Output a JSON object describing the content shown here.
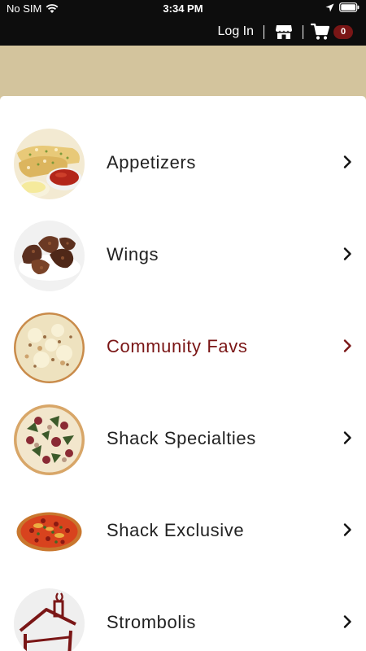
{
  "status_bar": {
    "carrier": "No SIM",
    "time": "3:34 PM"
  },
  "nav": {
    "login_label": "Log In",
    "cart_count": "0"
  },
  "colors": {
    "nav_bg": "#0d0d0d",
    "banner": "#d3c49d",
    "accent": "#7a1616",
    "text": "#222222"
  },
  "menu": {
    "items": [
      {
        "label": "Appetizers",
        "icon": "appetizers-thumbnail"
      },
      {
        "label": "Wings",
        "icon": "wings-thumbnail"
      },
      {
        "label": "Community Favs",
        "icon": "community-favs-thumbnail",
        "active": true
      },
      {
        "label": "Shack Specialties",
        "icon": "shack-specialties-thumbnail"
      },
      {
        "label": "Shack Exclusive",
        "icon": "shack-exclusive-thumbnail"
      },
      {
        "label": "Strombolis",
        "icon": "shack-logo-thumbnail"
      }
    ]
  }
}
